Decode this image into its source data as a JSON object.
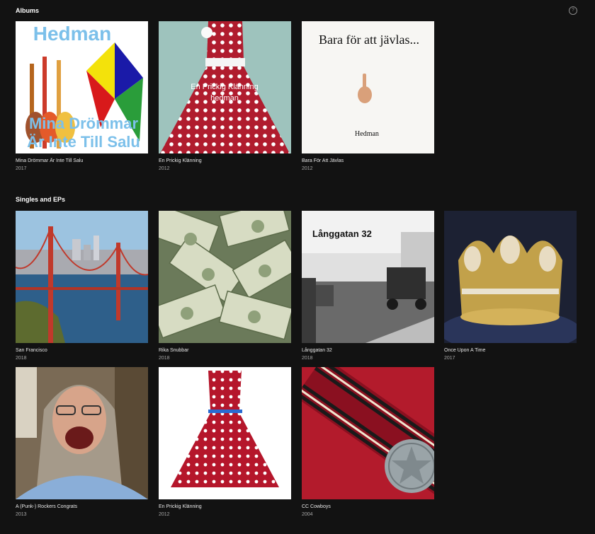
{
  "albums": {
    "heading": "Albums",
    "help_icon": "question-circle-icon",
    "items": [
      {
        "title": "Mina Drömmar Är Inte Till Salu",
        "year": "2017",
        "cover": {
          "t1": "Hedman",
          "t2": "Mina Drömmar",
          "t3": "Är Inte Till Salu"
        }
      },
      {
        "title": "En Prickig Klänning",
        "year": "2012",
        "cover": {
          "t1": "En Prickig Klänning",
          "t2": "hedman"
        }
      },
      {
        "title": "Bara För Att Jävlas",
        "year": "2012",
        "cover": {
          "t1": "Bara för att jävlas...",
          "t2": "Hedman"
        }
      }
    ]
  },
  "singles": {
    "heading": "Singles and EPs",
    "items": [
      {
        "title": "San Francisco",
        "year": "2018"
      },
      {
        "title": "Rika Snubbar",
        "year": "2018"
      },
      {
        "title": "Långgatan 32",
        "year": "2018",
        "cover": {
          "t1": "Långgatan 32"
        }
      },
      {
        "title": "Once Upon A Time",
        "year": "2017"
      },
      {
        "title": "A (Punk-) Rockers Congrats",
        "year": "2013"
      },
      {
        "title": "En Prickig Klänning",
        "year": "2012"
      },
      {
        "title": "CC Cowboys",
        "year": "2004"
      }
    ]
  },
  "colors": {
    "background": "#121212",
    "title": "#ffffff",
    "subtitle": "#a7a7a7"
  }
}
